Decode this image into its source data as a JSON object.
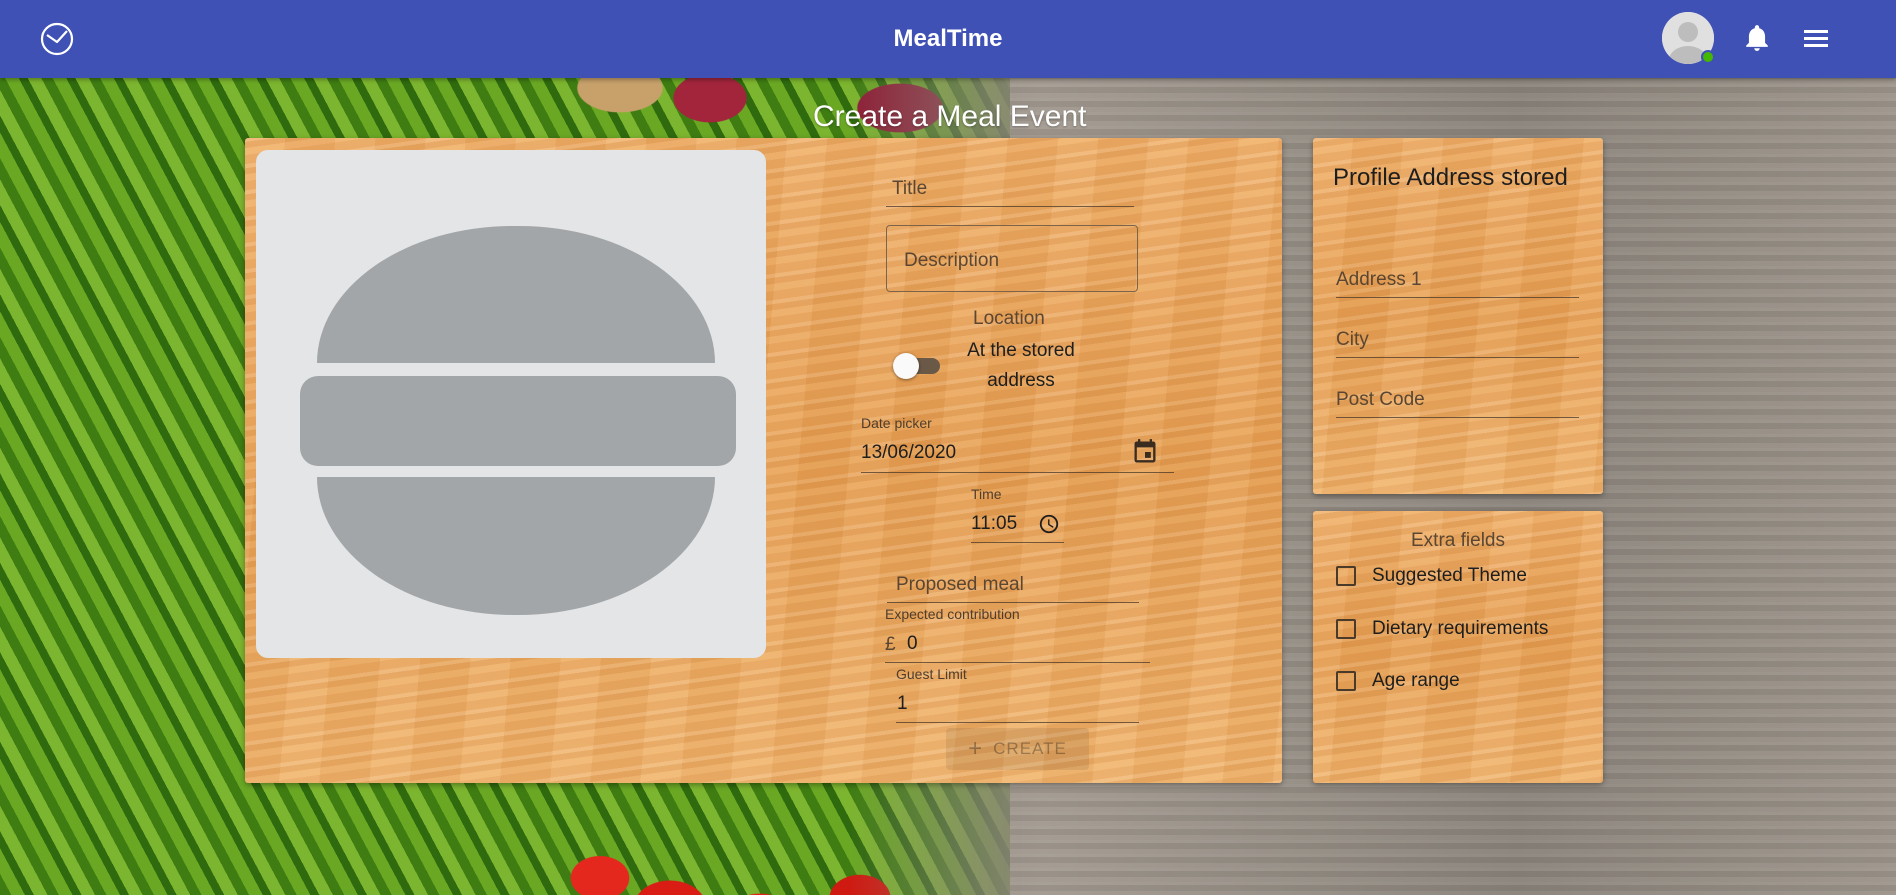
{
  "app": {
    "title": "MealTime"
  },
  "page": {
    "title": "Create a Meal Event"
  },
  "form": {
    "title_placeholder": "Title",
    "description_placeholder": "Description",
    "location_label": "Location",
    "location_toggle_text": "At the stored address",
    "location_toggle_on": false,
    "date_label": "Date picker",
    "date_value": "13/06/2020",
    "time_label": "Time",
    "time_value": "11:05",
    "proposed_meal_placeholder": "Proposed meal",
    "contribution_label": "Expected contribution",
    "contribution_currency": "£",
    "contribution_value": "0",
    "guest_limit_label": "Guest Limit",
    "guest_limit_value": "1",
    "create_label": "CREATE",
    "create_disabled": true
  },
  "address_card": {
    "title": "Profile Address stored",
    "address1_placeholder": "Address 1",
    "city_placeholder": "City",
    "postcode_placeholder": "Post Code"
  },
  "extra_fields": {
    "title": "Extra fields",
    "options": [
      {
        "label": "Suggested Theme",
        "checked": false
      },
      {
        "label": "Dietary requirements",
        "checked": false
      },
      {
        "label": "Age range",
        "checked": false
      }
    ]
  },
  "colors": {
    "appbar": "#3f51b5",
    "online_status": "#44b700"
  }
}
